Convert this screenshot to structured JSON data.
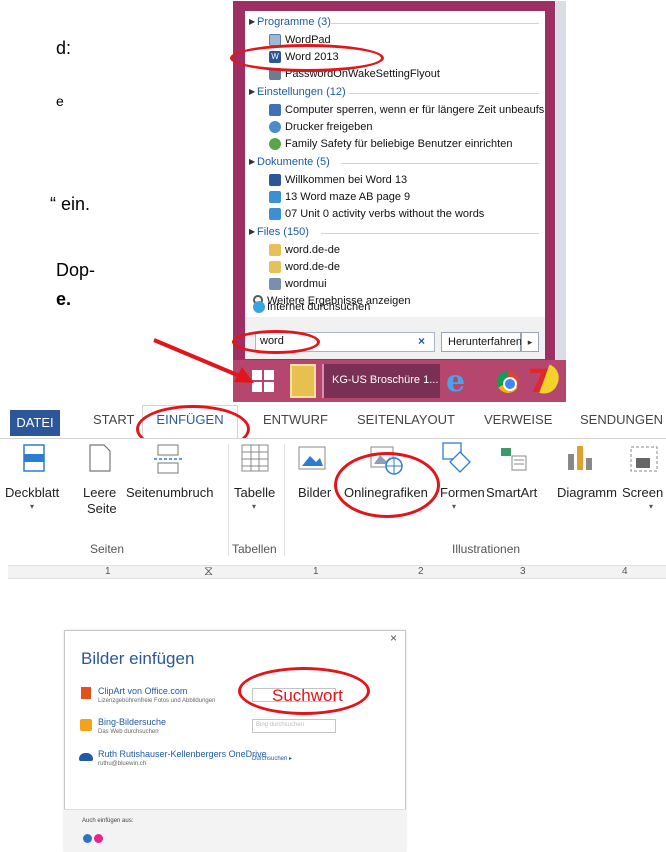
{
  "doc_fragments": [
    "d:",
    "e",
    "“ ein.",
    "Dop-",
    "e."
  ],
  "search_panel": {
    "groups": [
      {
        "label": "Programme (3)",
        "items": [
          "WordPad",
          "Word 2013",
          "PasswordOnWakeSettingFlyout"
        ]
      },
      {
        "label": "Einstellungen (12)",
        "items": [
          "Computer sperren, wenn er für längere Zeit unbeaufsichtigt ist",
          "Drucker freigeben",
          "Family Safety für beliebige Benutzer einrichten"
        ]
      },
      {
        "label": "Dokumente (5)",
        "items": [
          "Willkommen bei Word 13",
          "13 Word maze AB page 9",
          "07 Unit 0 activity verbs without the words"
        ]
      },
      {
        "label": "Files (150)",
        "items": [
          "word.de-de",
          "word.de-de",
          "wordmui"
        ]
      }
    ],
    "more_results": "Weitere Ergebnisse anzeigen",
    "internet_search": "Internet durchsuchen",
    "search_value": "word",
    "clear": "×",
    "shutdown": "Herunterfahren",
    "shutdown_arrow": "▸"
  },
  "taskbar": {
    "app_label": "KG-US Broschüre 1..."
  },
  "ribbon": {
    "tabs": [
      "DATEI",
      "START",
      "EINFÜGEN",
      "ENTWURF",
      "SEITENLAYOUT",
      "VERWEISE",
      "SENDUNGEN"
    ],
    "buttons": {
      "deckblatt": "Deckblatt",
      "leere_seite_1": "Leere",
      "leere_seite_2": "Seite",
      "seitenumbruch": "Seitenumbruch",
      "tabelle": "Tabelle",
      "bilder": "Bilder",
      "onlinegrafiken": "Onlinegrafiken",
      "formen": "Formen",
      "smartart": "SmartArt",
      "diagramm": "Diagramm",
      "screenshot": "Screen"
    },
    "groups": {
      "seiten": "Seiten",
      "tabellen": "Tabellen",
      "illustrationen": "Illustrationen"
    },
    "ruler_marks": [
      "1",
      "1",
      "2",
      "3",
      "4"
    ]
  },
  "dialog": {
    "close": "×",
    "title": "Bilder einfügen",
    "rows": [
      {
        "title": "ClipArt von Office.com",
        "subtitle": "Lizenzgebührenfreie Fotos und Abbildungen"
      },
      {
        "title": "Bing-Bildersuche",
        "subtitle": "Das Web durchsuchen",
        "placeholder": "Bing durchsuchen"
      },
      {
        "title": "Ruth Rutishauser-Kellenbergers OneDrive",
        "subtitle": "ruthu@bluewin.ch",
        "link": "Durchsuchen ▸"
      }
    ],
    "also_insert": "Auch einfügen aus:",
    "annotation": "Suchwort"
  },
  "colors": {
    "accent": "#2b579a",
    "start_frame": "#9e2f63",
    "annotation": "#e2151b"
  }
}
